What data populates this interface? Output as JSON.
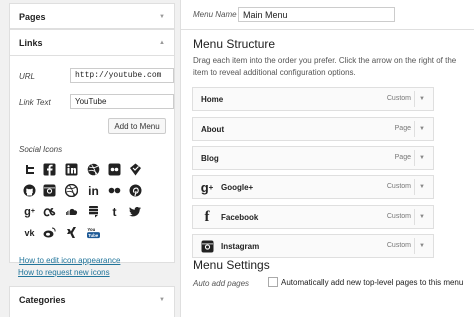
{
  "sidebar": {
    "pages_title": "Pages",
    "links_title": "Links",
    "categories_title": "Categories",
    "url_label": "URL",
    "url_value": "http://youtube.com",
    "link_text_label": "Link Text",
    "link_text_value": "YouTube",
    "add_button": "Add to Menu",
    "social_title": "Social Icons",
    "icons": [
      "twitter-icon",
      "facebook-icon",
      "linkedin-icon",
      "dribbble-icon",
      "flickr-icon",
      "foursquare-icon",
      "github-icon",
      "instagram-icon",
      "dribbble-icon",
      "linkedin-in-icon",
      "flickr-icon",
      "pinterest-icon",
      "google-plus-icon",
      "lastfm-icon",
      "soundcloud-icon",
      "stackexchange-icon",
      "tumblr-icon",
      "twitter-bird-icon",
      "vk-icon",
      "weibo-icon",
      "xing-icon",
      "youtube-icon"
    ],
    "edit_icon_link": "How to edit icon appearance",
    "request_icons_link": "How to request new icons"
  },
  "main": {
    "menu_name_label": "Menu Name",
    "menu_name_value": "Main Menu",
    "structure_title": "Menu Structure",
    "structure_desc": "Drag each item into the order you prefer. Click the arrow on the right of the item to reveal additional configuration options.",
    "items": [
      {
        "title": "Home",
        "type": "Custom",
        "icon": ""
      },
      {
        "title": "About",
        "type": "Page",
        "icon": ""
      },
      {
        "title": "Blog",
        "type": "Page",
        "icon": ""
      },
      {
        "title": "Google+",
        "type": "Custom",
        "icon": "google-plus-icon"
      },
      {
        "title": "Facebook",
        "type": "Custom",
        "icon": "facebook-icon"
      },
      {
        "title": "Instagram",
        "type": "Custom",
        "icon": "instagram-icon"
      }
    ],
    "settings_title": "Menu Settings",
    "auto_add_label": "Auto add pages",
    "auto_add_text": "Automatically add new top-level pages to this menu"
  },
  "colors": {
    "link": "#21759b",
    "border": "#dfdfdf",
    "background": "#f1f1f1"
  }
}
